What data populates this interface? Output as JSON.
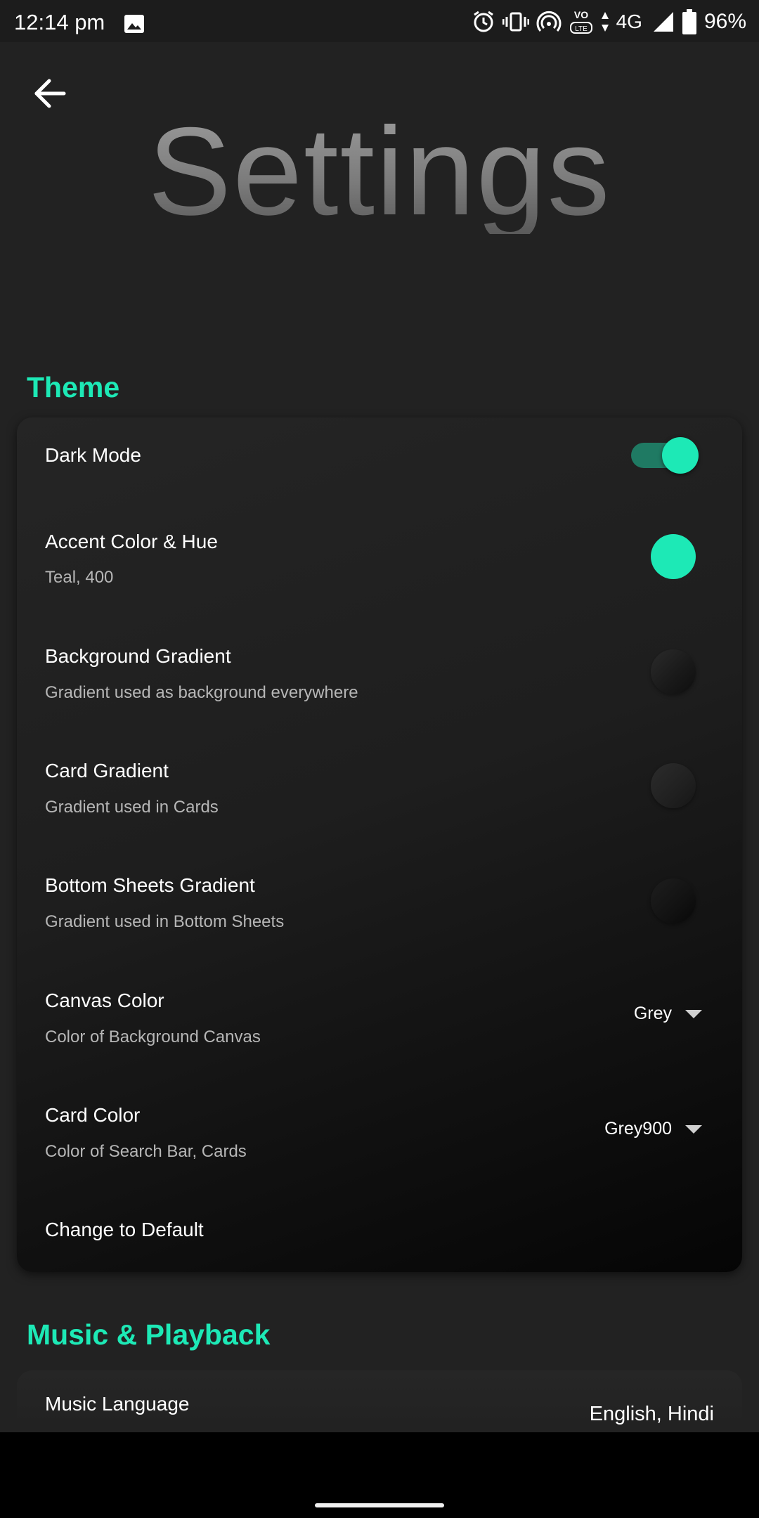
{
  "status_bar": {
    "time": "12:14 pm",
    "network": "4G",
    "battery": "96%",
    "icons": [
      "image-icon",
      "alarm-icon",
      "vibrate-icon",
      "hotspot-icon",
      "volte-icon",
      "data-arrows-icon",
      "signal-icon",
      "battery-icon"
    ]
  },
  "header": {
    "back_icon": "arrow-back-icon",
    "title": "Settings"
  },
  "theme": {
    "section_title": "Theme",
    "dark_mode": {
      "label": "Dark Mode",
      "enabled": true
    },
    "accent": {
      "label": "Accent Color & Hue",
      "sub": "Teal, 400",
      "color": "#1de9b6"
    },
    "background_gradient": {
      "label": "Background Gradient",
      "sub": "Gradient used as background everywhere"
    },
    "card_gradient": {
      "label": "Card Gradient",
      "sub": "Gradient used in Cards"
    },
    "bottom_sheets_gradient": {
      "label": "Bottom Sheets Gradient",
      "sub": "Gradient used in Bottom Sheets"
    },
    "canvas_color": {
      "label": "Canvas Color",
      "sub": "Color of Background Canvas",
      "value": "Grey"
    },
    "card_color": {
      "label": "Card Color",
      "sub": "Color of Search Bar, Cards",
      "value": "Grey900"
    },
    "change_default": {
      "label": "Change to Default"
    }
  },
  "music": {
    "section_title": "Music & Playback",
    "language": {
      "label": "Music Language",
      "value": "English, Hindi"
    }
  },
  "colors": {
    "accent": "#1de9b6",
    "background": "#222222",
    "nav_bar": "#000000"
  }
}
